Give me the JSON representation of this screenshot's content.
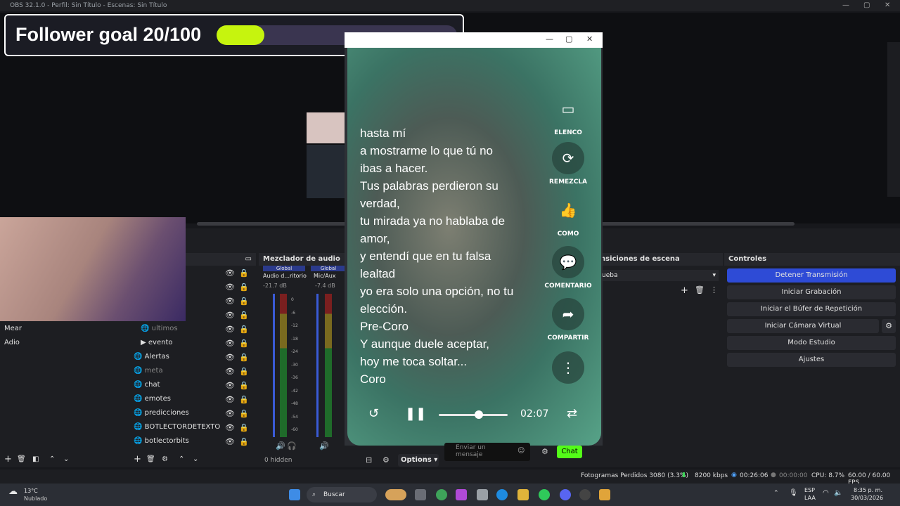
{
  "window": {
    "title": "OBS 32.1.0 - Perfil: Sin Título - Escenas: Sin Título"
  },
  "goal": {
    "text": "Follower goal 20/100",
    "progress": 0.2,
    "fill_color": "#c6f40e"
  },
  "player": {
    "lyrics": [
      "hasta mí",
      "a mostrarme lo que tú no",
      "ibas a hacer.",
      "Tus palabras perdieron su",
      "verdad,",
      "tu mirada ya no hablaba de",
      "amor,",
      "y entendí que en tu falsa",
      "lealtad",
      "yo era solo una opción, no tu",
      "elección.",
      "Pre-Coro",
      "Y aunque duele aceptar,",
      "hoy me toca soltar...",
      "Coro"
    ],
    "actions": {
      "cast": "ELENCO",
      "remix": "REMEZCLA",
      "like": "COMO",
      "comment": "COMENTARIO",
      "share": "COMPARTIR"
    },
    "time": "02:07",
    "progress": 0.58
  },
  "scenes": {
    "items": [
      "Mear",
      "Adio"
    ]
  },
  "sources": {
    "items": [
      "ultimos",
      "evento",
      "Alertas",
      "meta",
      "chat",
      "emotes",
      "predicciones",
      "BOTLECTORDETEXTO",
      "botlectorbits"
    ]
  },
  "mixer": {
    "title": "Mezclador de audio",
    "channels": [
      {
        "name": "Audio d...ritorio",
        "tag": "Global",
        "db": "-21.7 dB"
      },
      {
        "name": "Mic/Aux",
        "tag": "Global",
        "db": "-7.4 dB"
      }
    ],
    "scale": [
      "0",
      "-6",
      "-12",
      "-18",
      "-24",
      "-30",
      "-36",
      "-42",
      "-48",
      "-54",
      "-60"
    ],
    "hidden": "0 hidden",
    "options": "Options"
  },
  "transitions": {
    "title": "nsiciones de escena",
    "value": "ueba"
  },
  "controls": {
    "title": "Controles",
    "buttons": [
      "Detener Transmisión",
      "Iniciar Grabación",
      "Iniciar el Búfer de Repetición",
      "Iniciar Cámara Virtual",
      "Modo Estudio",
      "Ajustes"
    ],
    "accent": "#2e4bd6"
  },
  "chat": {
    "placeholder": "Enviar un mensaje",
    "button": "Chat"
  },
  "status": {
    "dropped": "Fotogramas Perdidos 3080 (3.3%)",
    "kbps": "8200 kbps",
    "stream_time": "00:26:06",
    "rec_time": "00:00:00",
    "cpu": "CPU: 8.7%",
    "fps": "60.00 / 60.00 FPS"
  },
  "taskbar": {
    "temp": "13°C",
    "weather": "Nublado",
    "search": "Buscar",
    "lang1": "ESP",
    "lang2": "LAA",
    "time": "8:35 p. m.",
    "date": "30/03/2026"
  }
}
